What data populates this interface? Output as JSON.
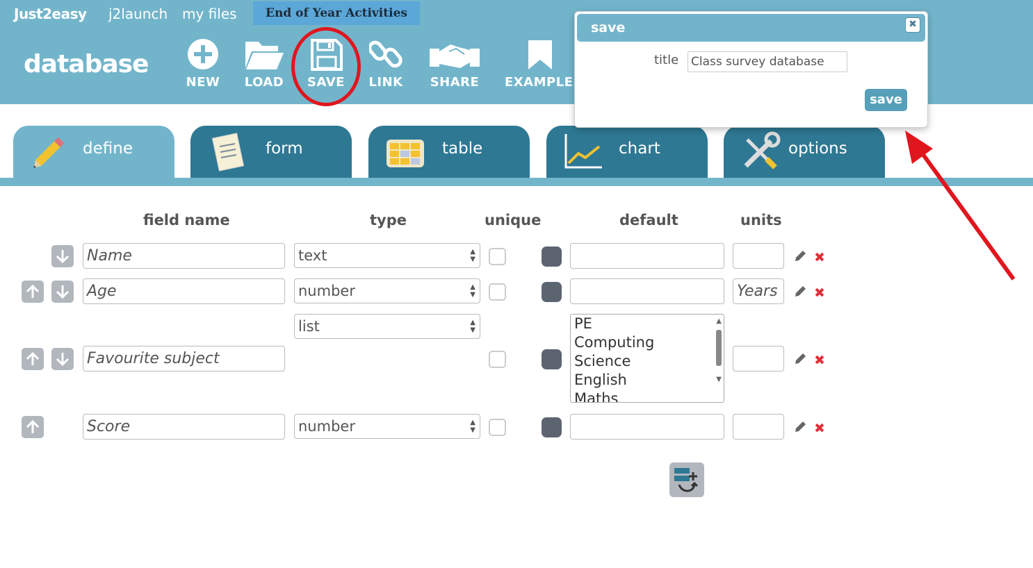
{
  "topnav": {
    "brand": "Just2easy",
    "launch": "j2launch",
    "files": "my files",
    "banner": "End of Year Activities"
  },
  "app": {
    "logo": "database"
  },
  "toolbar": {
    "new": "NEW",
    "load": "LOAD",
    "save": "SAVE",
    "link": "LINK",
    "share": "SHARE",
    "examples": "EXAMPLES"
  },
  "tabs": {
    "define": "define",
    "form": "form",
    "table": "table",
    "chart": "chart",
    "options": "options"
  },
  "columns": {
    "field_name": "field name",
    "type": "type",
    "unique": "unique",
    "default": "default",
    "units": "units"
  },
  "fields": [
    {
      "name": "Name",
      "type": "text",
      "default": "",
      "units": ""
    },
    {
      "name": "Age",
      "type": "number",
      "default": "",
      "units": "Years"
    },
    {
      "name": "Favourite subject",
      "type": "list",
      "default": "",
      "units": "",
      "options": [
        "PE",
        "Computing",
        "Science",
        "English",
        "Maths"
      ]
    },
    {
      "name": "Score",
      "type": "number",
      "default": "",
      "units": ""
    }
  ],
  "dialog": {
    "title": "save",
    "title_label": "title",
    "title_value": "Class survey database",
    "save_button": "save"
  },
  "colors": {
    "header": "#72b5cb",
    "tab_dark": "#2e7893",
    "annotation_red": "#e0161e",
    "delete_red": "#e0303a"
  }
}
